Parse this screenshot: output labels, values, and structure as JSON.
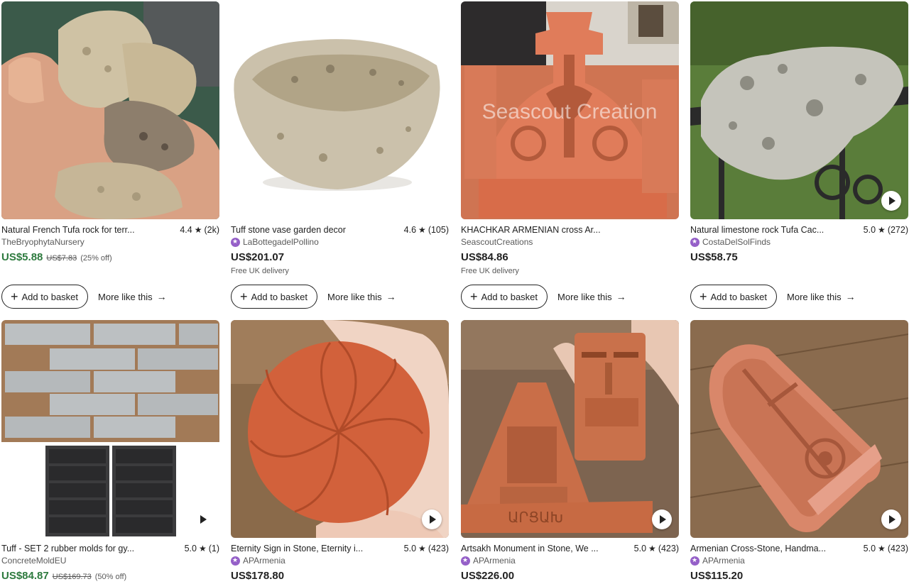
{
  "listings": [
    {
      "title": "Natural French Tufa rock for terr...",
      "rating": "4.4",
      "reviews": "(2k)",
      "shop": "TheBryophytaNursery",
      "star_seller": false,
      "price": "US$5.88",
      "sale": true,
      "original_price": "US$7.83",
      "discount": "(25% off)",
      "delivery": "",
      "video": false,
      "image_icon": "tufa-rocks-in-hand"
    },
    {
      "title": "Tuff stone vase garden decor",
      "rating": "4.6",
      "reviews": "(105)",
      "shop": "LaBottegadelPollino",
      "star_seller": true,
      "price": "US$201.07",
      "sale": false,
      "original_price": "",
      "discount": "",
      "delivery": "Free UK delivery",
      "video": false,
      "image_icon": "tuff-stone-bowl"
    },
    {
      "title": "KHACHKAR ARMENIAN cross Ar...",
      "rating": "",
      "reviews": "",
      "shop": "SeascoutCreations",
      "star_seller": false,
      "price": "US$84.86",
      "sale": false,
      "original_price": "",
      "discount": "",
      "delivery": "Free UK delivery",
      "video": false,
      "image_icon": "khachkar-carving",
      "watermark": "Seascout Creation"
    },
    {
      "title": "Natural limestone rock Tufa Cac...",
      "rating": "5.0",
      "reviews": "(272)",
      "shop": "CostaDelSolFinds",
      "star_seller": true,
      "price": "US$58.75",
      "sale": false,
      "original_price": "",
      "discount": "",
      "delivery": "",
      "video": true,
      "image_icon": "limestone-rock-on-fence"
    },
    {
      "title": "Tuff - SET 2 rubber molds for gy...",
      "rating": "5.0",
      "reviews": "(1)",
      "shop": "ConcreteMoldEU",
      "star_seller": false,
      "price": "US$84.87",
      "sale": true,
      "original_price": "US$169.73",
      "discount": "(50% off)",
      "delivery": "",
      "video": true,
      "image_icon": "stone-tiles-and-molds"
    },
    {
      "title": "Eternity Sign in Stone, Eternity i...",
      "rating": "5.0",
      "reviews": "(423)",
      "shop": "APArmenia",
      "star_seller": true,
      "price": "US$178.80",
      "sale": false,
      "original_price": "",
      "discount": "",
      "delivery": "",
      "video": true,
      "image_icon": "eternity-sign-stone"
    },
    {
      "title": "Artsakh Monument in Stone, We ...",
      "rating": "5.0",
      "reviews": "(423)",
      "shop": "APArmenia",
      "star_seller": true,
      "price": "US$226.00",
      "sale": false,
      "original_price": "",
      "discount": "",
      "delivery": "",
      "video": true,
      "image_icon": "artsakh-monument-stone",
      "engraving": "ԱՐՑԱԽ"
    },
    {
      "title": "Armenian Cross-Stone, Handma...",
      "rating": "5.0",
      "reviews": "(423)",
      "shop": "APArmenia",
      "star_seller": true,
      "price": "US$115.20",
      "sale": false,
      "original_price": "",
      "discount": "",
      "delivery": "",
      "video": true,
      "image_icon": "armenian-cross-stone"
    }
  ],
  "buttons": {
    "add_to_basket": "Add to basket",
    "more_like_this": "More like this"
  },
  "colors": {
    "sale_price": "#2d7a3e",
    "star_seller": "#9560c8",
    "text": "#222222",
    "muted": "#595959"
  }
}
